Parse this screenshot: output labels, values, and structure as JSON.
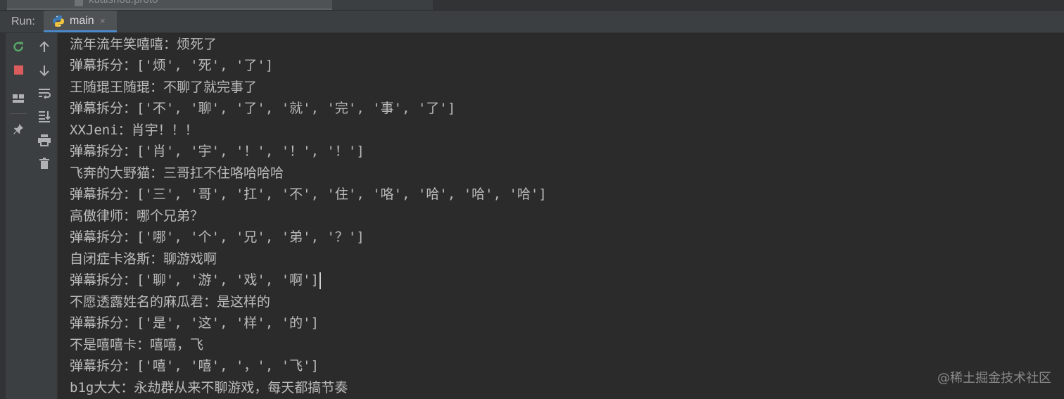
{
  "editor_tab": {
    "filename": "kuaishou.proto"
  },
  "run_panel": {
    "label": "Run:",
    "tab": {
      "name": "main",
      "close": "×"
    }
  },
  "toolbar": {
    "left": [
      "rerun-icon",
      "stop-icon",
      "layout-icon",
      "pin-icon"
    ],
    "right": [
      "up-arrow-icon",
      "down-arrow-icon",
      "soft-wrap-icon",
      "scroll-to-end-icon",
      "print-icon",
      "trash-icon"
    ]
  },
  "console": {
    "lines": [
      "流年流年笑嘻嘻：烦死了",
      "弹幕拆分：['烦', '死', '了']",
      "王随琨王随琨：不聊了就完事了",
      "弹幕拆分：['不', '聊', '了', '就', '完', '事', '了']",
      "XXJeni：肖宇！！！",
      "弹幕拆分：['肖', '宇', '！', '！', '！']",
      "飞奔的大野猫：三哥扛不住咯哈哈哈",
      "弹幕拆分：['三', '哥', '扛', '不', '住', '咯', '哈', '哈', '哈']",
      "高傲律师：哪个兄弟？",
      "弹幕拆分：['哪', '个', '兄', '弟', '？']",
      "自闭症卡洛斯：聊游戏啊",
      "弹幕拆分：['聊', '游', '戏', '啊']",
      "不愿透露姓名的麻瓜君：是这样的",
      "弹幕拆分：['是', '这', '样', '的']",
      "不是嘻嘻卡：嘻嘻，飞",
      "弹幕拆分：['嘻', '嘻', '，', '飞']",
      "b1g大大：永劫群从来不聊游戏，每天都搞节奏"
    ]
  },
  "watermark": "@稀土掘金技术社区",
  "colors": {
    "background": "#2b2b2b",
    "panel": "#3c3f41",
    "text": "#bbbbbb",
    "accent": "#4a88c7",
    "rerun": "#59a869",
    "stop": "#db5c5c"
  }
}
